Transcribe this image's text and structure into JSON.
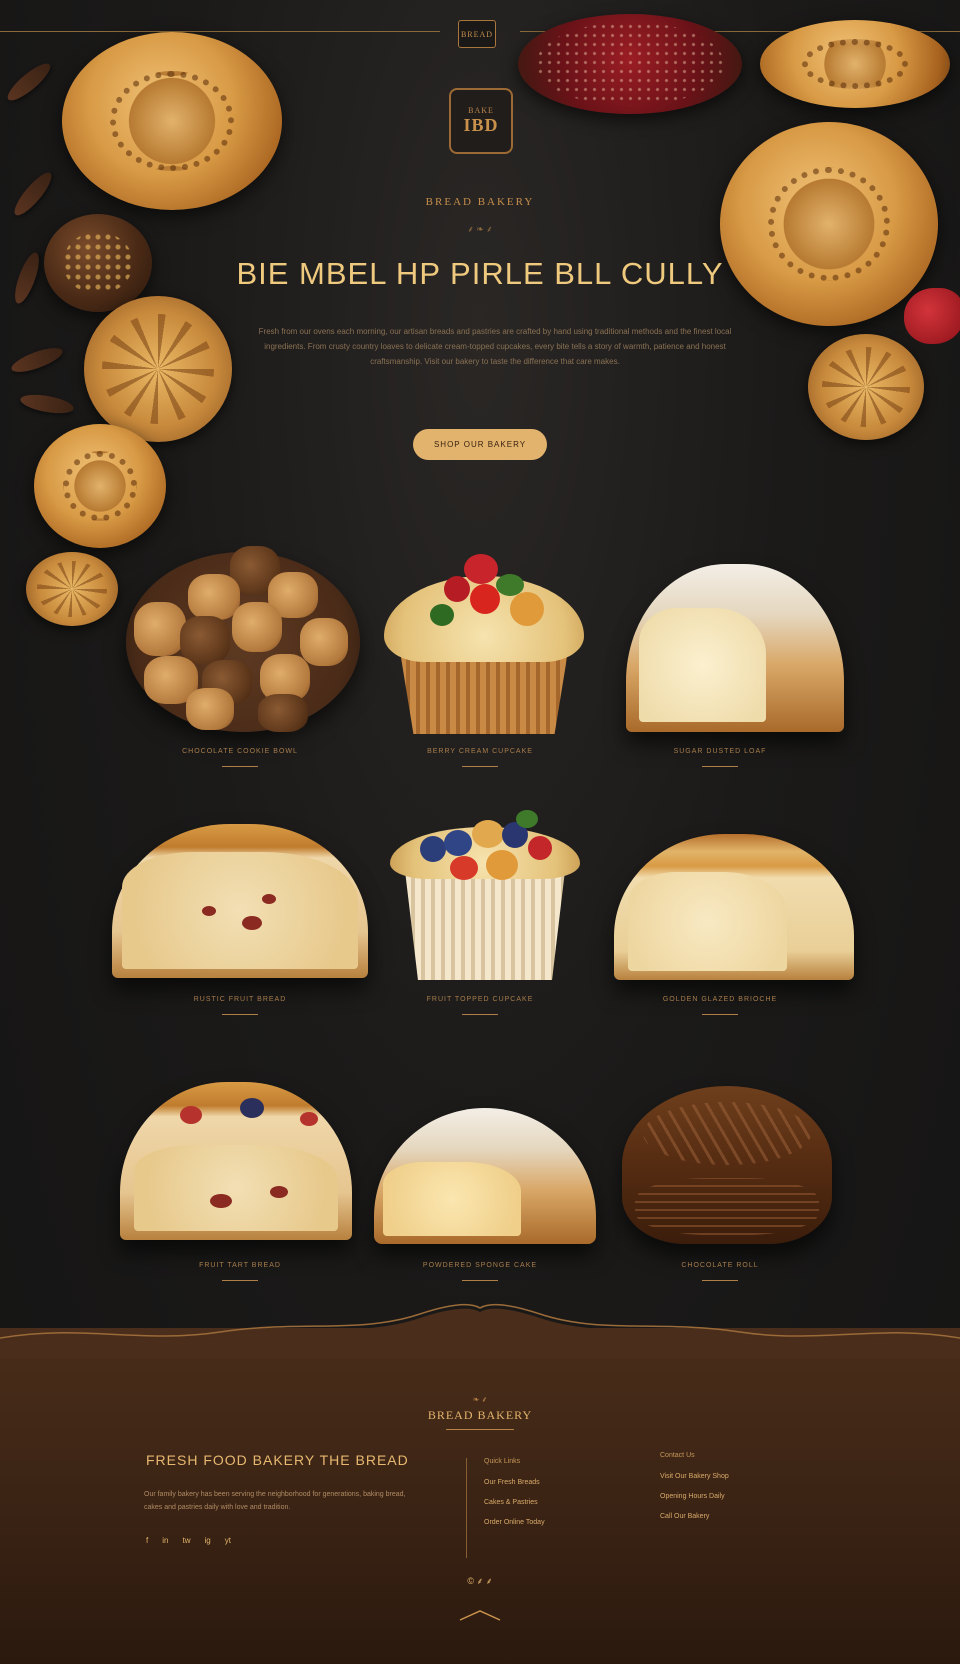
{
  "topbar": {
    "badge": "BREAD"
  },
  "hero": {
    "emblem_small": "BAKE",
    "emblem_big": "IBD",
    "kicker": "BREAD BAKERY",
    "kicker_ornament": "⸙ ❧ ⸙",
    "title": "BIE MBEL HP PIRLE BLL CULLY",
    "text": "Fresh from our ovens each morning, our artisan breads and pastries are crafted by hand using traditional methods and the finest local ingredients. From crusty country loaves to delicate cream-topped cupcakes, every bite tells a story of warmth, patience and honest craftsmanship. Visit our bakery to taste the difference that care makes.",
    "cta": "SHOP OUR BAKERY"
  },
  "products": [
    {
      "label": "CHOCOLATE COOKIE BOWL"
    },
    {
      "label": "BERRY CREAM CUPCAKE"
    },
    {
      "label": "SUGAR DUSTED LOAF"
    },
    {
      "label": "RUSTIC FRUIT BREAD"
    },
    {
      "label": "FRUIT TOPPED CUPCAKE"
    },
    {
      "label": "GOLDEN GLAZED BRIOCHE"
    },
    {
      "label": "FRUIT TART BREAD"
    },
    {
      "label": "POWDERED SPONGE CAKE"
    },
    {
      "label": "CHOCOLATE ROLL"
    }
  ],
  "footer": {
    "ornament": "❧ ⸙",
    "heading": "BREAD BAKERY",
    "title": "FRESH FOOD BAKERY THE BREAD",
    "text": "Our family bakery has been serving the neighborhood for generations, baking bread, cakes and pastries daily with love and tradition.",
    "social": [
      "f",
      "in",
      "tw",
      "ig",
      "yt"
    ],
    "col1": {
      "heading": "Quick Links",
      "items": [
        "Our Fresh Breads",
        "Cakes & Pastries",
        "Order Online Today"
      ]
    },
    "col2": {
      "heading": "Contact Us",
      "items": [
        "Visit Our Bakery Shop",
        "Opening Hours Daily",
        "Call Our Bakery"
      ]
    },
    "bottom": "© ⸙ ⸙"
  },
  "colors": {
    "background": "#161515",
    "accent": "#e2b36c",
    "footer": "#3d2515"
  }
}
